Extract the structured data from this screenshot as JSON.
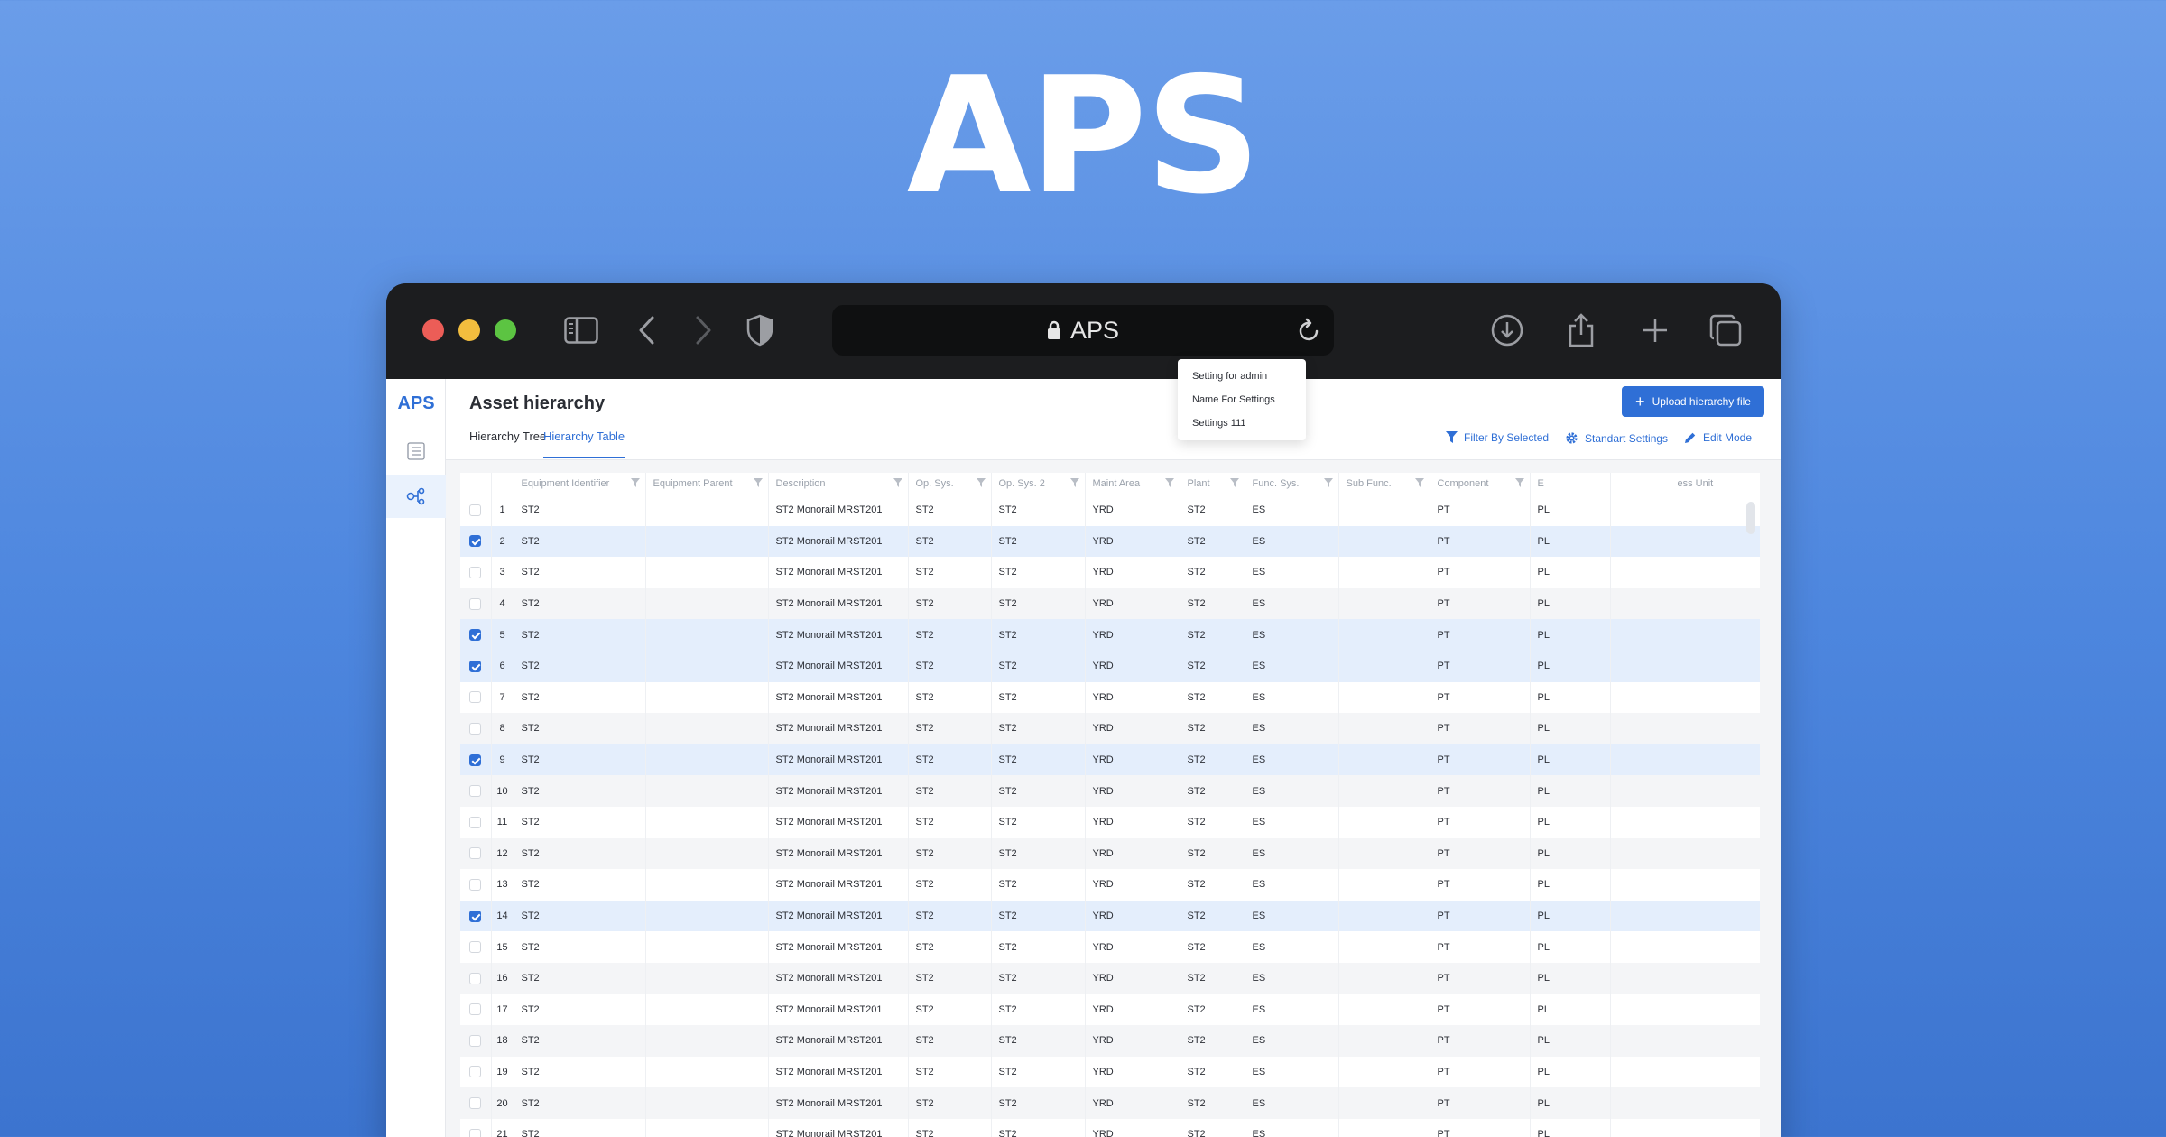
{
  "hero": {
    "title": "APS"
  },
  "browser": {
    "url": "APS",
    "icons": [
      "sidebar-toggle-icon",
      "back-icon",
      "forward-icon",
      "shield-icon",
      "lock-icon",
      "reload-icon",
      "download-icon",
      "share-icon",
      "new-tab-icon",
      "tabs-overview-icon"
    ]
  },
  "app": {
    "logo": "APS",
    "page_title": "Asset hierarchy",
    "upload_label": "Upload hierarchy file",
    "tabs": [
      {
        "label": "Hierarchy Tree",
        "active": false
      },
      {
        "label": "Hierarchy Table",
        "active": true
      }
    ],
    "actions": {
      "filter": "Filter By Selected",
      "settings": "Standart Settings",
      "edit": "Edit Mode"
    },
    "settings_menu": [
      "Setting for admin",
      "Name For Settings",
      "Settings 111"
    ],
    "accent_color": "#2f6fd6"
  },
  "table": {
    "columns": [
      "",
      "",
      "Equipment Identifier",
      "Equipment Parent",
      "Description",
      "Op. Sys.",
      "Op. Sys. 2",
      "Maint Area",
      "Plant",
      "Func. Sys.",
      "Sub Func.",
      "Component",
      "E",
      "ess Unit"
    ],
    "rows": [
      {
        "n": "1",
        "checked": false,
        "id": "ST2",
        "parent": "",
        "desc": "ST2 Monorail MRST201",
        "op": "ST2",
        "op2": "ST2",
        "area": "YRD",
        "plant": "ST2",
        "func": "ES",
        "sub": "",
        "comp": "PT",
        "e": "PL",
        "unit": ""
      },
      {
        "n": "2",
        "checked": true,
        "id": "ST2",
        "parent": "",
        "desc": "ST2 Monorail MRST201",
        "op": "ST2",
        "op2": "ST2",
        "area": "YRD",
        "plant": "ST2",
        "func": "ES",
        "sub": "",
        "comp": "PT",
        "e": "PL",
        "unit": ""
      },
      {
        "n": "3",
        "checked": false,
        "id": "ST2",
        "parent": "",
        "desc": "ST2 Monorail MRST201",
        "op": "ST2",
        "op2": "ST2",
        "area": "YRD",
        "plant": "ST2",
        "func": "ES",
        "sub": "",
        "comp": "PT",
        "e": "PL",
        "unit": ""
      },
      {
        "n": "4",
        "checked": false,
        "id": "ST2",
        "parent": "",
        "desc": "ST2 Monorail MRST201",
        "op": "ST2",
        "op2": "ST2",
        "area": "YRD",
        "plant": "ST2",
        "func": "ES",
        "sub": "",
        "comp": "PT",
        "e": "PL",
        "unit": ""
      },
      {
        "n": "5",
        "checked": true,
        "id": "ST2",
        "parent": "",
        "desc": "ST2 Monorail MRST201",
        "op": "ST2",
        "op2": "ST2",
        "area": "YRD",
        "plant": "ST2",
        "func": "ES",
        "sub": "",
        "comp": "PT",
        "e": "PL",
        "unit": ""
      },
      {
        "n": "6",
        "checked": true,
        "id": "ST2",
        "parent": "",
        "desc": "ST2 Monorail MRST201",
        "op": "ST2",
        "op2": "ST2",
        "area": "YRD",
        "plant": "ST2",
        "func": "ES",
        "sub": "",
        "comp": "PT",
        "e": "PL",
        "unit": ""
      },
      {
        "n": "7",
        "checked": false,
        "id": "ST2",
        "parent": "",
        "desc": "ST2 Monorail MRST201",
        "op": "ST2",
        "op2": "ST2",
        "area": "YRD",
        "plant": "ST2",
        "func": "ES",
        "sub": "",
        "comp": "PT",
        "e": "PL",
        "unit": ""
      },
      {
        "n": "8",
        "checked": false,
        "id": "ST2",
        "parent": "",
        "desc": "ST2 Monorail MRST201",
        "op": "ST2",
        "op2": "ST2",
        "area": "YRD",
        "plant": "ST2",
        "func": "ES",
        "sub": "",
        "comp": "PT",
        "e": "PL",
        "unit": ""
      },
      {
        "n": "9",
        "checked": true,
        "id": "ST2",
        "parent": "",
        "desc": "ST2 Monorail MRST201",
        "op": "ST2",
        "op2": "ST2",
        "area": "YRD",
        "plant": "ST2",
        "func": "ES",
        "sub": "",
        "comp": "PT",
        "e": "PL",
        "unit": ""
      },
      {
        "n": "10",
        "checked": false,
        "id": "ST2",
        "parent": "",
        "desc": "ST2 Monorail MRST201",
        "op": "ST2",
        "op2": "ST2",
        "area": "YRD",
        "plant": "ST2",
        "func": "ES",
        "sub": "",
        "comp": "PT",
        "e": "PL",
        "unit": ""
      },
      {
        "n": "11",
        "checked": false,
        "id": "ST2",
        "parent": "",
        "desc": "ST2 Monorail MRST201",
        "op": "ST2",
        "op2": "ST2",
        "area": "YRD",
        "plant": "ST2",
        "func": "ES",
        "sub": "",
        "comp": "PT",
        "e": "PL",
        "unit": ""
      },
      {
        "n": "12",
        "checked": false,
        "id": "ST2",
        "parent": "",
        "desc": "ST2 Monorail MRST201",
        "op": "ST2",
        "op2": "ST2",
        "area": "YRD",
        "plant": "ST2",
        "func": "ES",
        "sub": "",
        "comp": "PT",
        "e": "PL",
        "unit": ""
      },
      {
        "n": "13",
        "checked": false,
        "id": "ST2",
        "parent": "",
        "desc": "ST2 Monorail MRST201",
        "op": "ST2",
        "op2": "ST2",
        "area": "YRD",
        "plant": "ST2",
        "func": "ES",
        "sub": "",
        "comp": "PT",
        "e": "PL",
        "unit": ""
      },
      {
        "n": "14",
        "checked": true,
        "id": "ST2",
        "parent": "",
        "desc": "ST2 Monorail MRST201",
        "op": "ST2",
        "op2": "ST2",
        "area": "YRD",
        "plant": "ST2",
        "func": "ES",
        "sub": "",
        "comp": "PT",
        "e": "PL",
        "unit": ""
      },
      {
        "n": "15",
        "checked": false,
        "id": "ST2",
        "parent": "",
        "desc": "ST2 Monorail MRST201",
        "op": "ST2",
        "op2": "ST2",
        "area": "YRD",
        "plant": "ST2",
        "func": "ES",
        "sub": "",
        "comp": "PT",
        "e": "PL",
        "unit": ""
      },
      {
        "n": "16",
        "checked": false,
        "id": "ST2",
        "parent": "",
        "desc": "ST2 Monorail MRST201",
        "op": "ST2",
        "op2": "ST2",
        "area": "YRD",
        "plant": "ST2",
        "func": "ES",
        "sub": "",
        "comp": "PT",
        "e": "PL",
        "unit": ""
      },
      {
        "n": "17",
        "checked": false,
        "id": "ST2",
        "parent": "",
        "desc": "ST2 Monorail MRST201",
        "op": "ST2",
        "op2": "ST2",
        "area": "YRD",
        "plant": "ST2",
        "func": "ES",
        "sub": "",
        "comp": "PT",
        "e": "PL",
        "unit": ""
      },
      {
        "n": "18",
        "checked": false,
        "id": "ST2",
        "parent": "",
        "desc": "ST2 Monorail MRST201",
        "op": "ST2",
        "op2": "ST2",
        "area": "YRD",
        "plant": "ST2",
        "func": "ES",
        "sub": "",
        "comp": "PT",
        "e": "PL",
        "unit": ""
      },
      {
        "n": "19",
        "checked": false,
        "id": "ST2",
        "parent": "",
        "desc": "ST2 Monorail MRST201",
        "op": "ST2",
        "op2": "ST2",
        "area": "YRD",
        "plant": "ST2",
        "func": "ES",
        "sub": "",
        "comp": "PT",
        "e": "PL",
        "unit": ""
      },
      {
        "n": "20",
        "checked": false,
        "id": "ST2",
        "parent": "",
        "desc": "ST2 Monorail MRST201",
        "op": "ST2",
        "op2": "ST2",
        "area": "YRD",
        "plant": "ST2",
        "func": "ES",
        "sub": "",
        "comp": "PT",
        "e": "PL",
        "unit": ""
      },
      {
        "n": "21",
        "checked": false,
        "id": "ST2",
        "parent": "",
        "desc": "ST2 Monorail MRST201",
        "op": "ST2",
        "op2": "ST2",
        "area": "YRD",
        "plant": "ST2",
        "func": "ES",
        "sub": "",
        "comp": "PT",
        "e": "PL",
        "unit": ""
      }
    ]
  }
}
